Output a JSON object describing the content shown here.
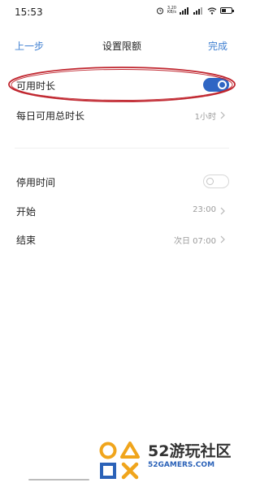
{
  "status_bar": {
    "time": "15:53",
    "net_speed_value": "3.20",
    "net_speed_unit": "KB/s",
    "battery_level": 0.42
  },
  "header": {
    "back_label": "上一步",
    "title": "设置限额",
    "done_label": "完成"
  },
  "settings": {
    "usable_duration": {
      "label": "可用时长",
      "enabled": true
    },
    "daily_total": {
      "label": "每日可用总时长",
      "value": "1小时"
    },
    "downtime": {
      "label": "停用时间",
      "enabled": false
    },
    "start": {
      "label": "开始",
      "value": "23:00"
    },
    "end": {
      "label": "结束",
      "value": "次日 07:00"
    }
  },
  "watermark": {
    "brand": "52游玩社区",
    "domain": "52GAMERS.COM"
  },
  "colors": {
    "accent": "#3f7fd1",
    "toggle_on": "#2f66c4",
    "annotation": "#c0262f"
  }
}
